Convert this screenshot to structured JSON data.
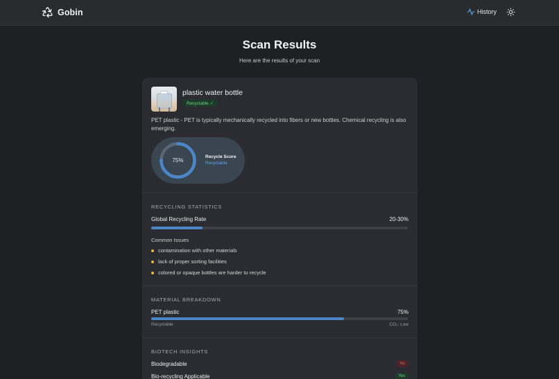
{
  "app": {
    "name": "Gobin",
    "logo_icon": "recycle-logo-icon"
  },
  "nav": {
    "history_label": "History",
    "history_icon": "activity-icon",
    "theme_icon": "sun-icon"
  },
  "page": {
    "title": "Scan Results",
    "subtitle": "Here are the results of your scan"
  },
  "item": {
    "name": "plastic water bottle",
    "status_badge": "Recyclable ✓",
    "description": "PET plastic - PET is typically mechanically recycled into fibers or new bottles. Chemical recycling is also emerging.",
    "score": {
      "value": "75%",
      "percent": 75,
      "label": "Recycle Score",
      "status": "Recyclable"
    }
  },
  "recycling_statistics": {
    "heading": "RECYCLING STATISTICS",
    "rate_label": "Global Recycling Rate",
    "rate_value": "20-30%",
    "rate_fill_percent": 20,
    "issues_heading": "Common Issues",
    "issues": [
      "contamination with other materials",
      "lack of proper sorting facilities",
      "colored or opaque bottles are harder to recycle"
    ]
  },
  "material_breakdown": {
    "heading": "MATERIAL BREAKDOWN",
    "material": "PET plastic",
    "percent_label": "75%",
    "percent": 75,
    "recyclability": "Recyclable",
    "co2": "CO₂: Low"
  },
  "biotech_insights": {
    "heading": "BIOTECH INSIGHTS",
    "rows": [
      {
        "label": "Biodegradable",
        "value": "No"
      },
      {
        "label": "Bio-recycling Applicable",
        "value": "Yes"
      }
    ]
  },
  "colors": {
    "background": "#1f2023",
    "card": "#2b2c31",
    "accent_blue": "#4a86c8",
    "success_green": "#6fcf8a",
    "warning_yellow": "#e7b73a",
    "danger_red": "#d66060"
  }
}
